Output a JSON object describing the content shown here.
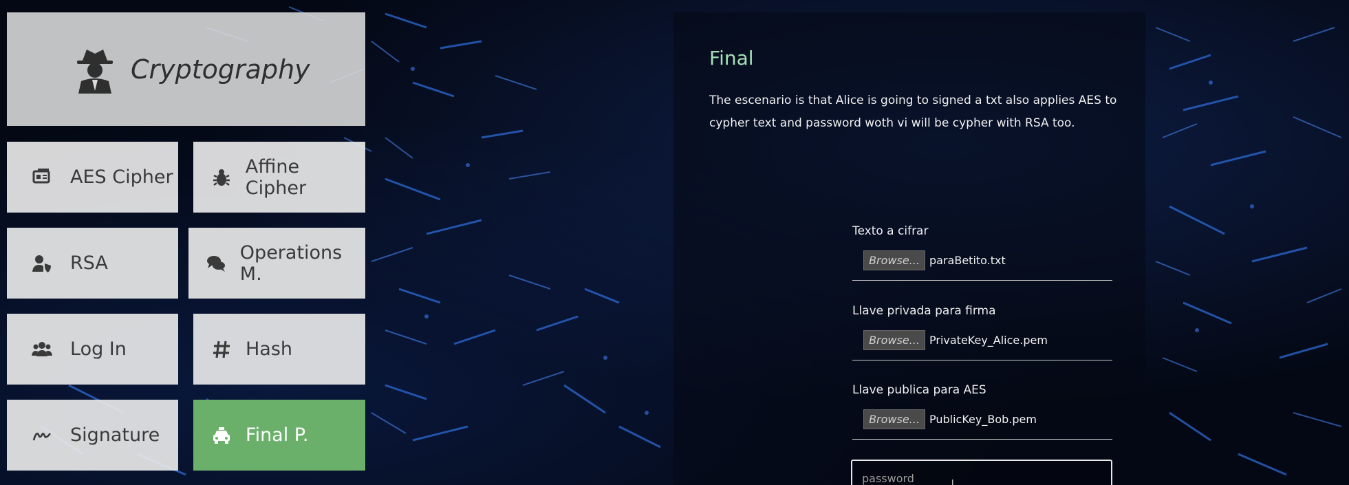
{
  "app": {
    "title": "Cryptography"
  },
  "menu": {
    "items": [
      {
        "label": "AES Cipher",
        "icon": "id-card-icon"
      },
      {
        "label": "Affine Cipher",
        "icon": "bug-icon"
      },
      {
        "label": "RSA",
        "icon": "user-shield-icon"
      },
      {
        "label": "Operations M.",
        "icon": "comments-icon"
      },
      {
        "label": "Log In",
        "icon": "users-icon"
      },
      {
        "label": "Hash",
        "icon": "hashtag-icon"
      },
      {
        "label": "Signature",
        "icon": "signature-icon"
      },
      {
        "label": "Final P.",
        "icon": "taxi-icon"
      }
    ],
    "active_index": 7
  },
  "panel": {
    "heading": "Final",
    "description": "The escenario is that Alice is going to signed a txt also applies AES to cypher text and password woth vi will be cypher with RSA too.",
    "fields": [
      {
        "label": "Texto a cifrar",
        "button": "Browse...",
        "file": "paraBetito.txt"
      },
      {
        "label": "Llave privada para firma",
        "button": "Browse...",
        "file": "PrivateKey_Alice.pem"
      },
      {
        "label": "Llave publica para AES",
        "button": "Browse...",
        "file": "PublicKey_Bob.pem"
      }
    ],
    "password_placeholder": "password"
  },
  "colors": {
    "accent_green": "#6ab06a",
    "heading_green": "#a5e1b7",
    "tile_bg": "#e8e8e8",
    "background": "#040814"
  }
}
